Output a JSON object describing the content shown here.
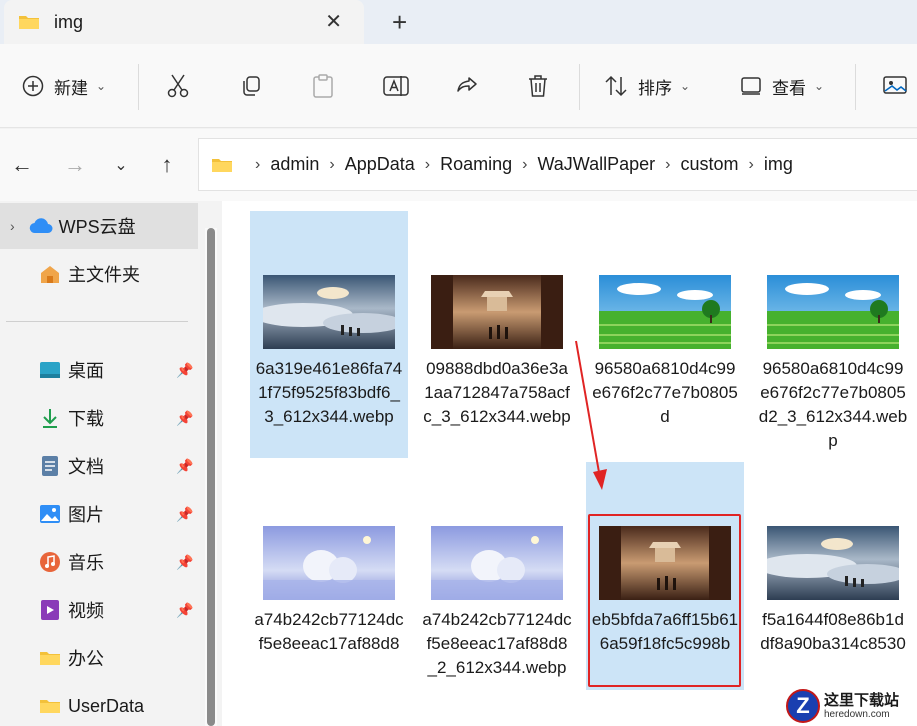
{
  "tab": {
    "title": "img",
    "close": "✕",
    "new": "+"
  },
  "toolbar": {
    "new_label": "新建",
    "sort_label": "排序",
    "view_label": "查看"
  },
  "address": {
    "segments": [
      "admin",
      "AppData",
      "Roaming",
      "WaJWallPaper",
      "custom",
      "img"
    ]
  },
  "sidebar": {
    "items": [
      {
        "label": "WPS云盘"
      },
      {
        "label": "主文件夹"
      },
      {
        "label": "桌面"
      },
      {
        "label": "下载"
      },
      {
        "label": "文档"
      },
      {
        "label": "图片"
      },
      {
        "label": "音乐"
      },
      {
        "label": "视频"
      },
      {
        "label": "办公"
      },
      {
        "label": "UserData"
      }
    ]
  },
  "files": [
    {
      "name": "6a319e461e86fa741f75f9525f83bdf6_3_612x344.webp",
      "thumb": "clouds"
    },
    {
      "name": "09888dbd0a36e3a1aa712847a758acfc_3_612x344.webp",
      "thumb": "temple"
    },
    {
      "name": "96580a6810d4c99e676f2c77e7b0805d",
      "thumb": "field"
    },
    {
      "name": "96580a6810d4c99e676f2c77e7b0805d2_3_612x344.webp",
      "thumb": "field"
    },
    {
      "name": "a74b242cb77124dcf5e8eeac17af88d8",
      "thumb": "snowy"
    },
    {
      "name": "a74b242cb77124dcf5e8eeac17af88d8_2_612x344.webp",
      "thumb": "snowy"
    },
    {
      "name": "eb5bfda7a6ff15b616a59f18fc5c998b",
      "thumb": "temple"
    },
    {
      "name": "f5a1644f08e86b1ddf8a90ba314c8530",
      "thumb": "clouds"
    }
  ],
  "logo": {
    "cn": "这里下载站",
    "url": "heredown.com"
  },
  "colors": {
    "accent": "#0067c0",
    "selection": "#cce4f7",
    "highlight": "#e02424"
  }
}
